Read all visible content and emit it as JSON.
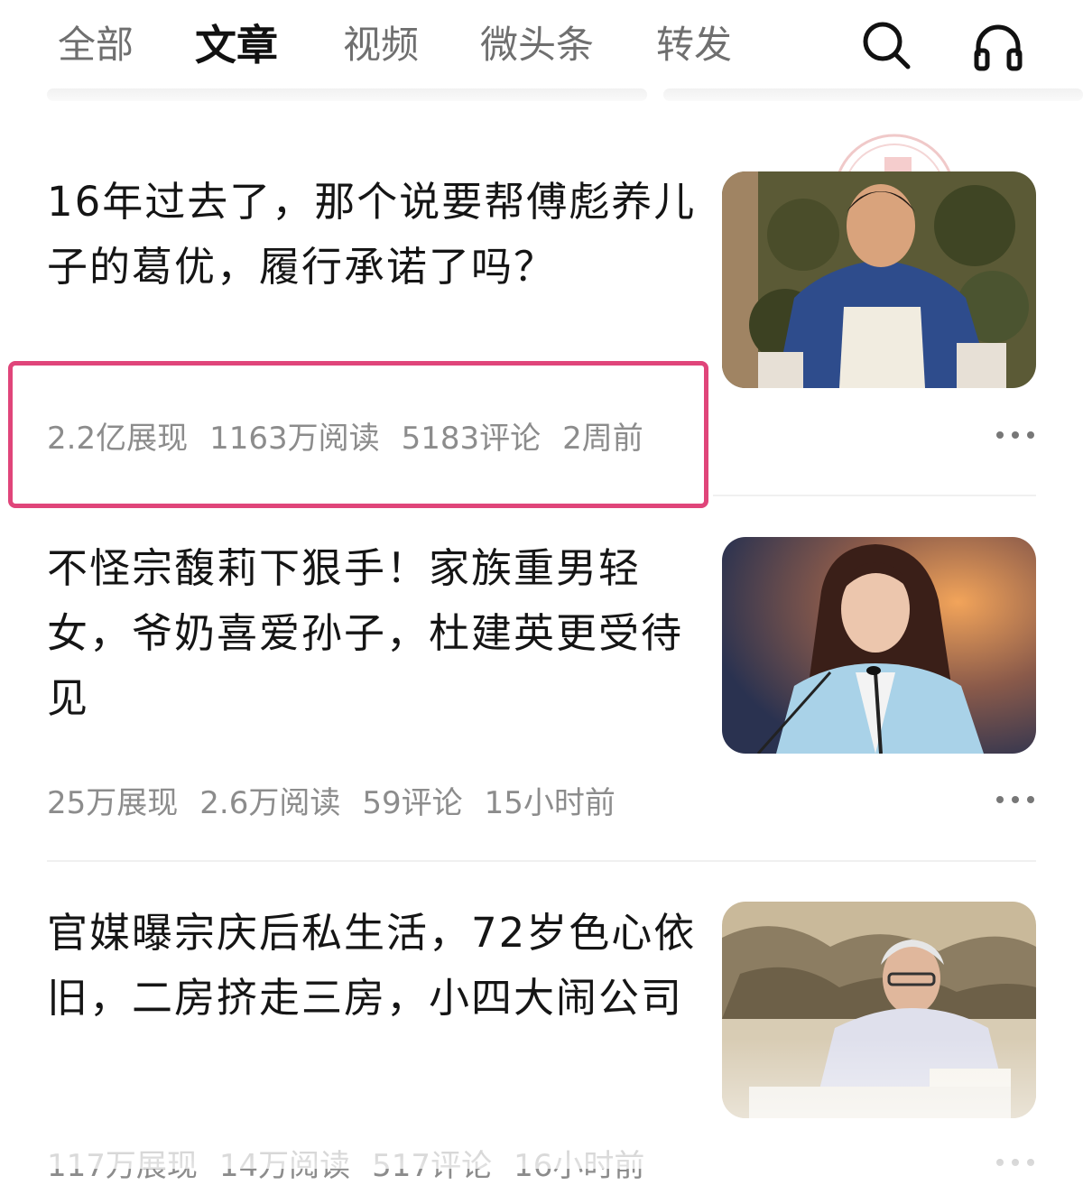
{
  "tabs": [
    {
      "label": "全部",
      "active": false
    },
    {
      "label": "文章",
      "active": true
    },
    {
      "label": "视频",
      "active": false
    },
    {
      "label": "微头条",
      "active": false
    },
    {
      "label": "转发",
      "active": false
    }
  ],
  "icons": {
    "search": "search-icon",
    "listen": "headphones-icon",
    "more": "more-dots-icon"
  },
  "highlight_color": "#e0457a",
  "articles": [
    {
      "title": "16年过去了，那个说要帮傅彪养儿子的葛优，履行承诺了吗？",
      "stats": {
        "views": "2.2亿展现",
        "reads": "1163万阅读",
        "comments": "5183评论",
        "time": "2周前"
      },
      "highlighted": true
    },
    {
      "title": "不怪宗馥莉下狠手！家族重男轻女，爷奶喜爱孙子，杜建英更受待见",
      "stats": {
        "views": "25万展现",
        "reads": "2.6万阅读",
        "comments": "59评论",
        "time": "15小时前"
      },
      "highlighted": false
    },
    {
      "title": "官媒曝宗庆后私生活，72岁色心依旧，二房挤走三房，小四大闹公司",
      "stats": {
        "views": "117万展现",
        "reads": "14万阅读",
        "comments": "517评论",
        "time": "16小时前"
      },
      "highlighted": false
    }
  ]
}
